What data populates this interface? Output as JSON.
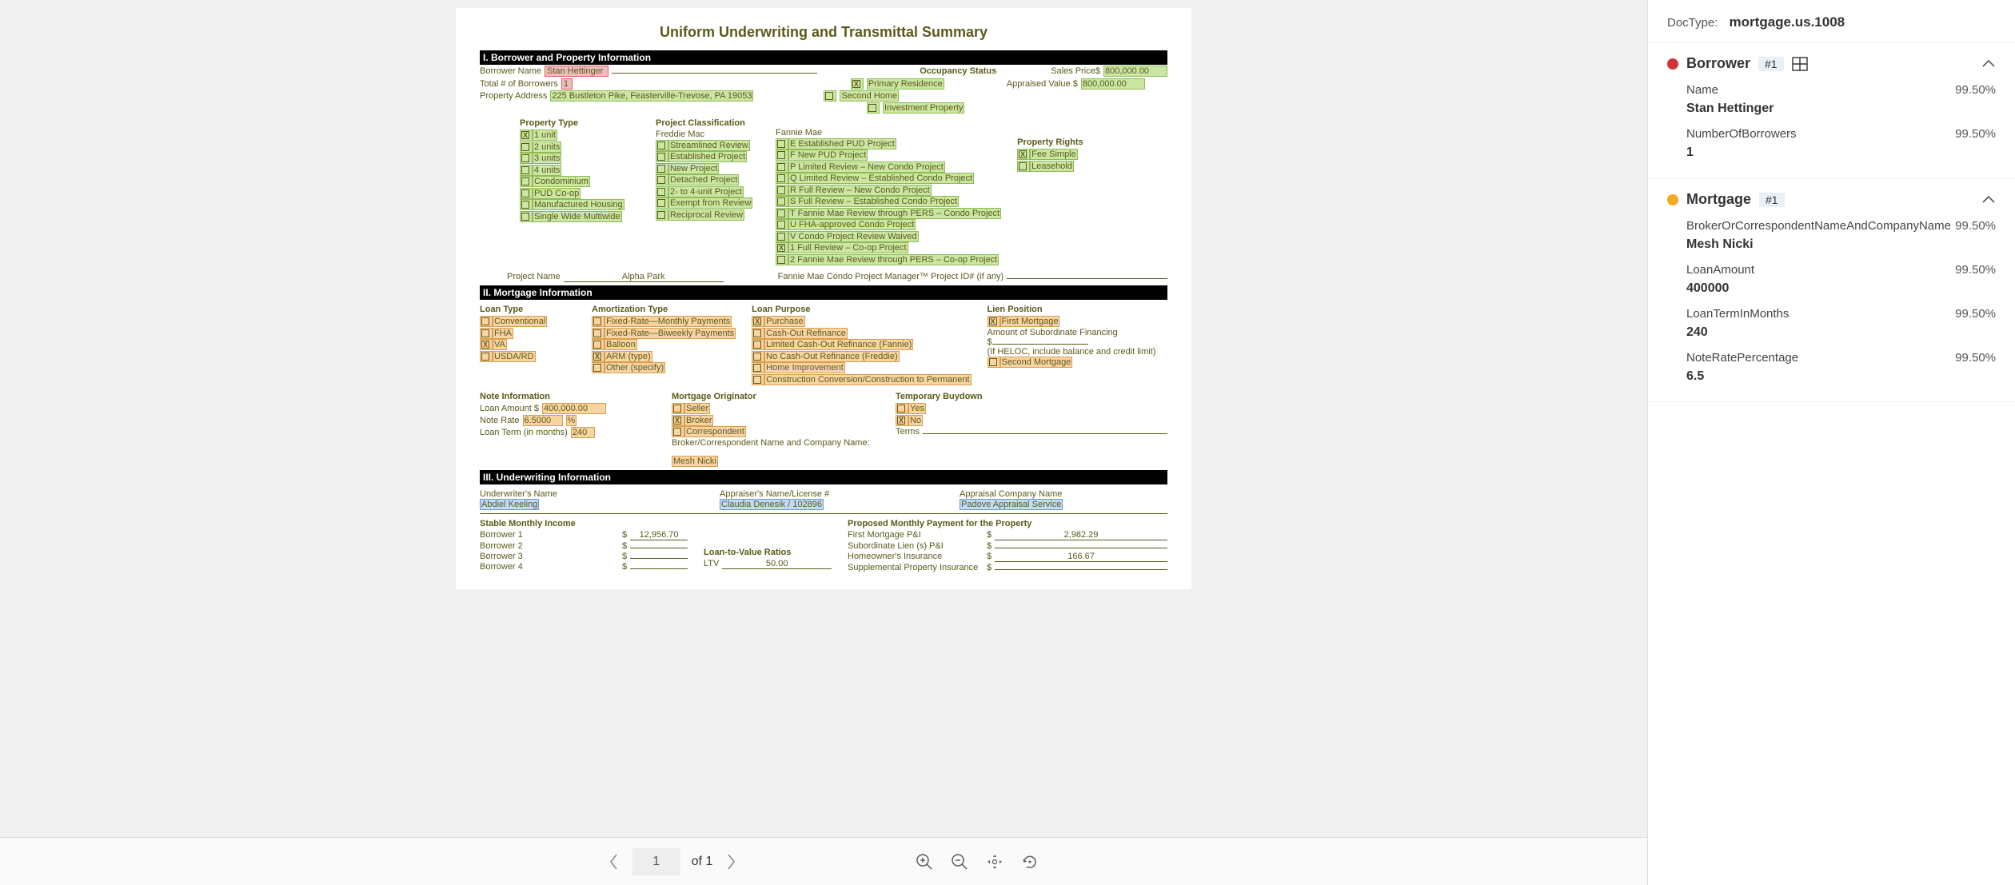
{
  "doc": {
    "title": "Uniform Underwriting and Transmittal Summary",
    "section1": {
      "title": "I. Borrower and Property Information",
      "borrowerNameLbl": "Borrower Name",
      "borrowerName": "Stan Hettinger",
      "totalBorrowersLbl": "Total # of Borrowers",
      "totalBorrowers": "1",
      "propertyAddressLbl": "Property Address",
      "propertyAddress": "225 Bustleton Pike, Feasterville-Trevose, PA 19053",
      "occupancyStatusLbl": "Occupancy Status",
      "occPrimary": "Primary Residence",
      "occSecond": "Second Home",
      "occInvest": "Investment Property",
      "salesPriceLbl": "Sales Price$",
      "salesPrice": "800,000.00",
      "appraisedLbl": "Appraised Value $",
      "appraised": "800,000.00",
      "propertyTypeLbl": "Property Type",
      "ptItems": [
        "1 unit",
        "2 units",
        "3 units",
        "4 units",
        "Condominium",
        "PUD      Co-op",
        "Manufactured Housing",
        "Single Wide    Multiwide"
      ],
      "projectClassLbl": "Project Classification",
      "freddieLbl": "Freddie Mac",
      "freddieItems": [
        "Streamlined Review",
        "Established Project",
        "New Project",
        "Detached Project",
        "2- to 4-unit Project",
        "Exempt from Review",
        "Reciprocal Review"
      ],
      "fannieLbl": "Fannie Mae",
      "fannieItems": [
        "E Established PUD Project",
        "F New PUD Project",
        "P Limited Review – New Condo Project",
        "Q Limited Review – Established Condo Project",
        "R Full Review – New Condo Project",
        "S Full Review – Established Condo Project",
        "T Fannie Mae Review through PERS – Condo Project",
        "U FHA-approved Condo Project",
        "V Condo Project Review Waived",
        "1 Full Review – Co-op Project",
        "2 Fannie Mae Review through PERS – Co-op Project"
      ],
      "propertyRightsLbl": "Property Rights",
      "prFee": "Fee Simple",
      "prLease": "Leasehold",
      "projectNameLbl": "Project Name",
      "projectName": "Alpha Park",
      "fannieProjectIdLbl": "Fannie Mae Condo Project Manager™ Project ID# (if any)"
    },
    "section2": {
      "title": "II. Mortgage Information",
      "loanTypeLbl": "Loan Type",
      "ltItems": [
        "Conventional",
        "FHA",
        "VA",
        "USDA/RD"
      ],
      "amortLbl": "Amortization Type",
      "amortItems": [
        "Fixed-Rate—Monthly Payments",
        "Fixed-Rate—Biweekly Payments",
        "Balloon",
        "ARM (type)",
        "Other (specify)"
      ],
      "loanPurposeLbl": "Loan Purpose",
      "lpItems": [
        "Purchase",
        "Cash-Out Refinance",
        "Limited Cash-Out Refinance (Fannie)",
        "No Cash-Out Refinance (Freddie)",
        "Home Improvement",
        "Construction Conversion/Construction to Permanent"
      ],
      "lienLbl": "Lien Position",
      "lienFirst": "First Mortgage",
      "lienSubLbl": "Amount of Subordinate Financing",
      "lienDollar": "$",
      "lienHeloc": "(If HELOC, include balance and credit limit)",
      "lienSecond": "Second Mortgage",
      "noteInfoLbl": "Note Information",
      "loanAmountLbl": "Loan Amount $",
      "loanAmount": "400,000.00",
      "noteRateLbl": "Note Rate",
      "noteRate": "6.5000",
      "pct": "%",
      "loanTermLbl": "Loan Term (in months)",
      "loanTerm": "240",
      "mortOrigLbl": "Mortgage Originator",
      "moItems": [
        "Seller",
        "Broker",
        "Correspondent"
      ],
      "brokerCorrLbl": "Broker/Correspondent Name and Company Name:",
      "brokerCorr": "Mesh Nicki",
      "tempBuydownLbl": "Temporary Buydown",
      "yes": "Yes",
      "no": "No",
      "termsLbl": "Terms"
    },
    "section3": {
      "title": "III. Underwriting Information",
      "uwNameLbl": "Underwriter's Name",
      "uwName": "Abdiel Keeling",
      "apprNameLbl": "Appraiser's Name/License #",
      "apprName": "Claudia Denesik / 102896",
      "apprCompLbl": "Appraisal Company Name",
      "apprComp": "Padove Appraisal Service",
      "stableLbl": "Stable Monthly Income",
      "b1": "Borrower 1",
      "b2": "Borrower 2",
      "b3": "Borrower 3",
      "b4": "Borrower 4",
      "b1val": "12,956.70",
      "ltvLbl": "Loan-to-Value Ratios",
      "ltv": "LTV",
      "ltvVal": "50.00",
      "proposedLbl": "Proposed Monthly Payment for the Property",
      "pmFirst": "First Mortgage P&I",
      "pmSub": "Subordinate Lien (s) P&I",
      "pmHome": "Homeowner's Insurance",
      "pmSupp": "Supplemental Property Insurance",
      "pmFirstVal": "2,982.29",
      "pmHomeVal": "166.67",
      "dollar": "$"
    }
  },
  "toolbar": {
    "page": "1",
    "ofTotal": "of 1"
  },
  "panel": {
    "docTypeLbl": "DocType:",
    "docType": "mortgage.us.1008",
    "groups": {
      "borrower": {
        "name": "Borrower",
        "tag": "#1"
      },
      "mortgage": {
        "name": "Mortgage",
        "tag": "#1"
      }
    },
    "fields": {
      "name": {
        "label": "Name",
        "conf": "99.50%",
        "value": "Stan Hettinger"
      },
      "numBorrowers": {
        "label": "NumberOfBorrowers",
        "conf": "99.50%",
        "value": "1"
      },
      "broker": {
        "label": "BrokerOrCorrespondentNameAndCompanyName",
        "conf": "99.50%",
        "value": "Mesh Nicki"
      },
      "loanAmount": {
        "label": "LoanAmount",
        "conf": "99.50%",
        "value": "400000"
      },
      "loanTerm": {
        "label": "LoanTermInMonths",
        "conf": "99.50%",
        "value": "240"
      },
      "noteRate": {
        "label": "NoteRatePercentage",
        "conf": "99.50%",
        "value": "6.5"
      }
    }
  }
}
